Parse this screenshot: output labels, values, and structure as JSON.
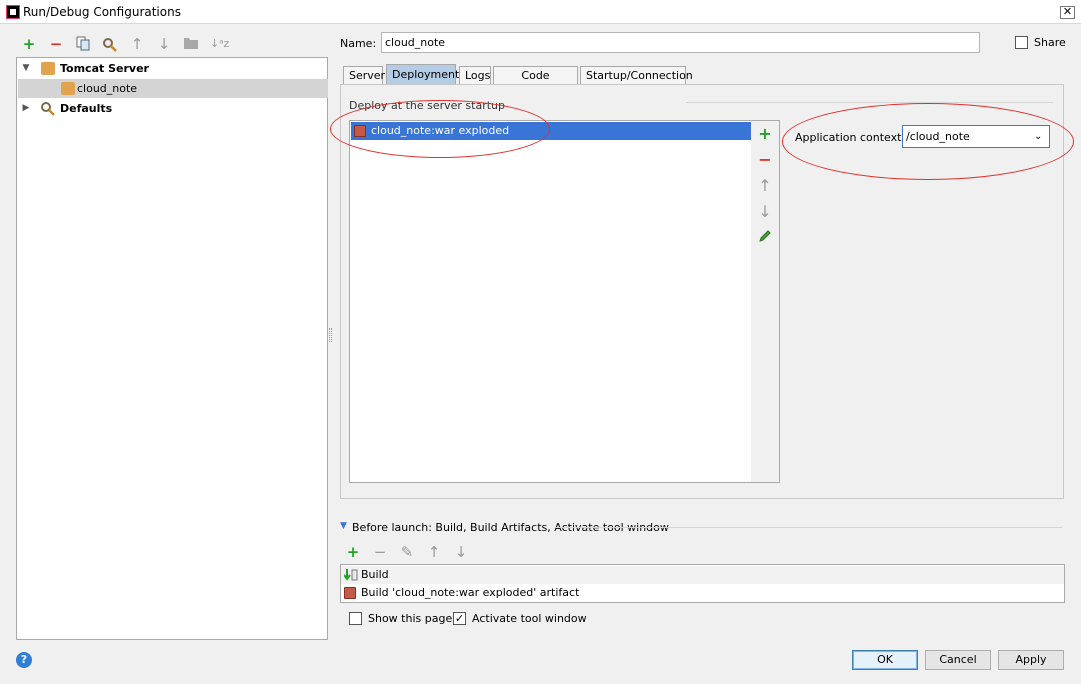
{
  "window": {
    "title": "Run/Debug Configurations",
    "close_glyph": "✕"
  },
  "left_toolbar": {
    "icons": [
      "add-icon",
      "remove-icon",
      "copy-icon",
      "edit-defaults-icon",
      "move-up-icon",
      "move-down-icon",
      "folder-icon",
      "sort-icon"
    ]
  },
  "tree": {
    "items": [
      {
        "label": "Tomcat Server",
        "expanded": true
      },
      {
        "label": "cloud_note",
        "selected": true
      },
      {
        "label": "Defaults",
        "expanded": false
      }
    ]
  },
  "name_field": {
    "label": "Name:",
    "value": "cloud_note"
  },
  "share": {
    "label": "Share",
    "checked": false
  },
  "tabs": [
    {
      "label": "Server"
    },
    {
      "label": "Deployment",
      "selected": true
    },
    {
      "label": "Logs"
    },
    {
      "label": "Code Coverage"
    },
    {
      "label": "Startup/Connection"
    }
  ],
  "deployment": {
    "section_label": "Deploy at the server startup",
    "items": [
      "cloud_note:war exploded"
    ],
    "app_context_label": "Application context:",
    "app_context_value": "/cloud_note"
  },
  "before_launch": {
    "title": "Before launch: Build, Build Artifacts, Activate tool window",
    "items": [
      "Build",
      "Build 'cloud_note:war exploded' artifact"
    ],
    "show_this_page": {
      "label": "Show this page",
      "checked": false
    },
    "activate_tool_window": {
      "label": "Activate tool window",
      "checked": true
    }
  },
  "buttons": {
    "ok": "OK",
    "cancel": "Cancel",
    "apply": "Apply",
    "help": "?"
  },
  "colors": {
    "accent": "#3875d7",
    "selection": "#d4d4d4",
    "add": "#27a02a",
    "remove": "#d23a2f",
    "annotation": "#e0302c"
  }
}
